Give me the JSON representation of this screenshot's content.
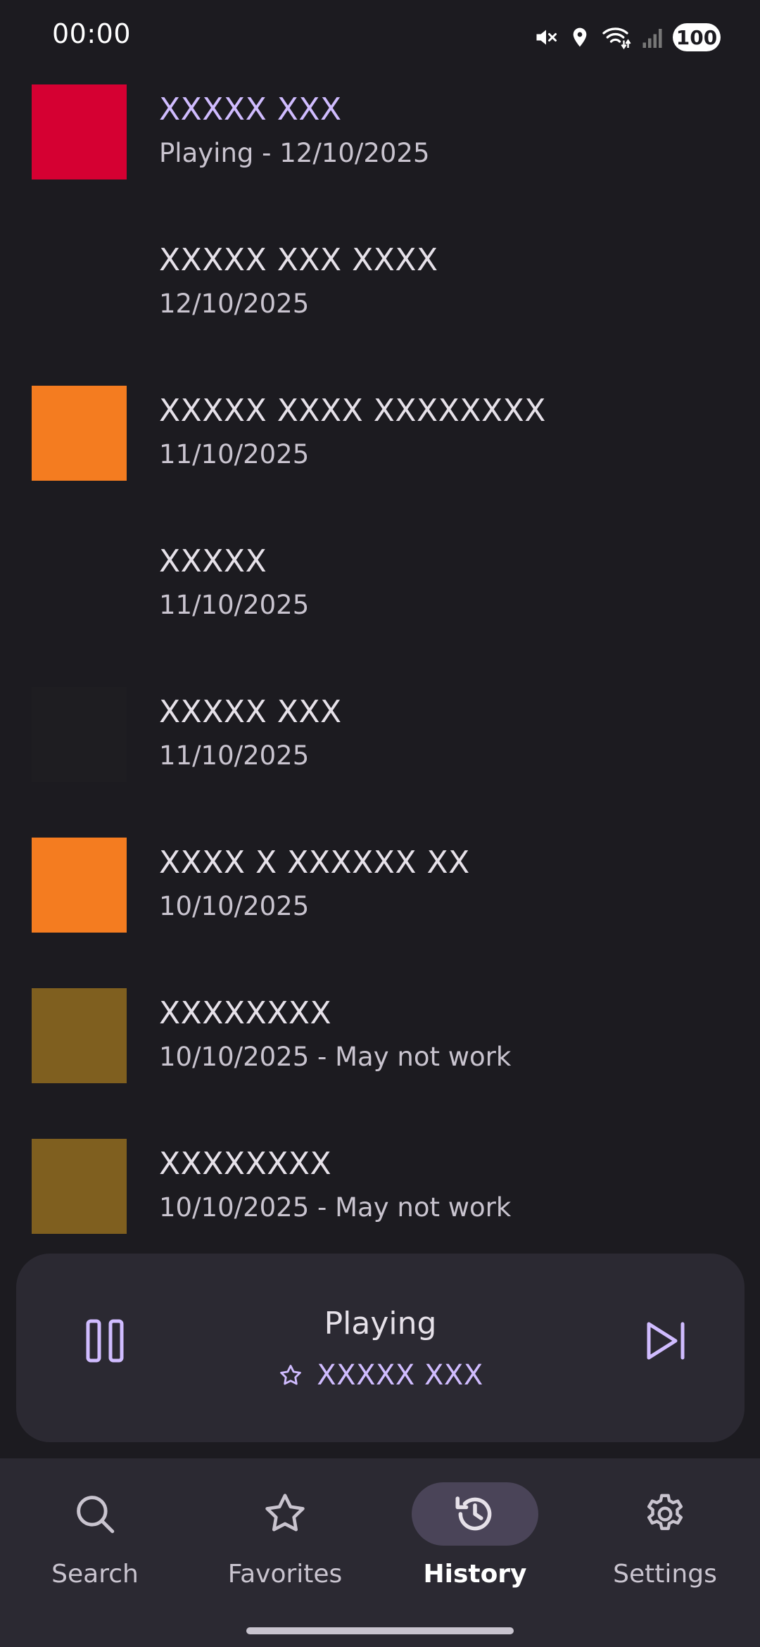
{
  "status_bar": {
    "time": "00:00",
    "battery": "100",
    "icons": [
      "mute-icon",
      "location-icon",
      "wifi-icon",
      "signal-icon",
      "battery-icon"
    ]
  },
  "history": {
    "items": [
      {
        "title": "XXXXX XXX",
        "subtitle": "Playing - 12/10/2025",
        "color": "#d50032",
        "active": true
      },
      {
        "title": "XXXXX XXX XXXX",
        "subtitle": "12/10/2025",
        "color": "#1c1b20",
        "active": false
      },
      {
        "title": "XXXXX XXXX XXXXXXXX",
        "subtitle": "11/10/2025",
        "color": "#f47c20",
        "active": false
      },
      {
        "title": "XXXXX",
        "subtitle": "11/10/2025",
        "color": "#1c1b20",
        "active": false
      },
      {
        "title": "XXXXX XXX",
        "subtitle": "11/10/2025",
        "color": "#1e1d21",
        "active": false
      },
      {
        "title": "XXXX X XXXXXX XX",
        "subtitle": "10/10/2025",
        "color": "#f47c20",
        "active": false
      },
      {
        "title": "XXXXXXXX",
        "subtitle": "10/10/2025 - May not work",
        "color": "#7f5f1f",
        "active": false
      },
      {
        "title": "XXXXXXXX",
        "subtitle": "10/10/2025 - May not work",
        "color": "#7f5f1f",
        "active": false
      }
    ]
  },
  "now_playing": {
    "status": "Playing",
    "track": "XXXXX XXX",
    "pause_icon": "pause-icon",
    "skip_icon": "skip-next-icon",
    "favorite_icon": "star-outline-icon"
  },
  "nav": {
    "items": [
      {
        "label": "Search",
        "icon": "search-icon",
        "active": false
      },
      {
        "label": "Favorites",
        "icon": "star-outline-icon",
        "active": false
      },
      {
        "label": "History",
        "icon": "history-icon",
        "active": true
      },
      {
        "label": "Settings",
        "icon": "gear-icon",
        "active": false
      }
    ]
  },
  "colors": {
    "background": "#1c1b20",
    "surface": "#2b2932",
    "accent": "#d0bcff",
    "active_indicator": "#4a4458"
  }
}
